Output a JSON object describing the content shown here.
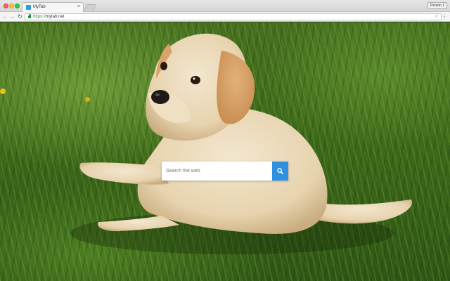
{
  "browser": {
    "tab": {
      "title": "MyTab",
      "close_icon": "×",
      "favicon": "mytab-favicon"
    },
    "profile_label": "Person 1",
    "url": {
      "scheme": "https://",
      "host": "mytab.net"
    },
    "icons": [
      "back-icon",
      "forward-icon",
      "reload-icon",
      "lock-icon",
      "star-icon",
      "menu-icon"
    ]
  },
  "search": {
    "placeholder": "Search the web",
    "button_icon": "search-icon",
    "button_color": "#2f8fe0"
  },
  "background": {
    "subject": "puppy-in-grass"
  }
}
